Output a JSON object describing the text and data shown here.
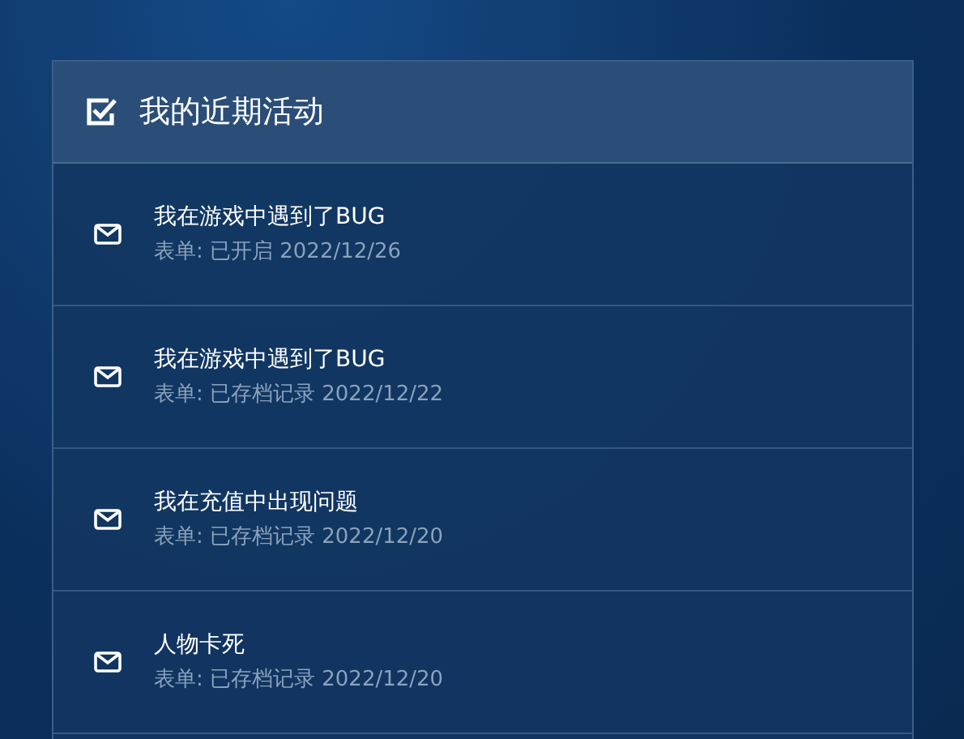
{
  "panel": {
    "title": "我的近期活动",
    "items": [
      {
        "title": "我在游戏中遇到了BUG",
        "meta": "表单: 已开启 2022/12/26"
      },
      {
        "title": "我在游戏中遇到了BUG",
        "meta": "表单: 已存档记录 2022/12/22"
      },
      {
        "title": "我在充值中出现问题",
        "meta": "表单: 已存档记录 2022/12/20"
      },
      {
        "title": "人物卡死",
        "meta": "表单: 已存档记录 2022/12/20"
      }
    ]
  }
}
